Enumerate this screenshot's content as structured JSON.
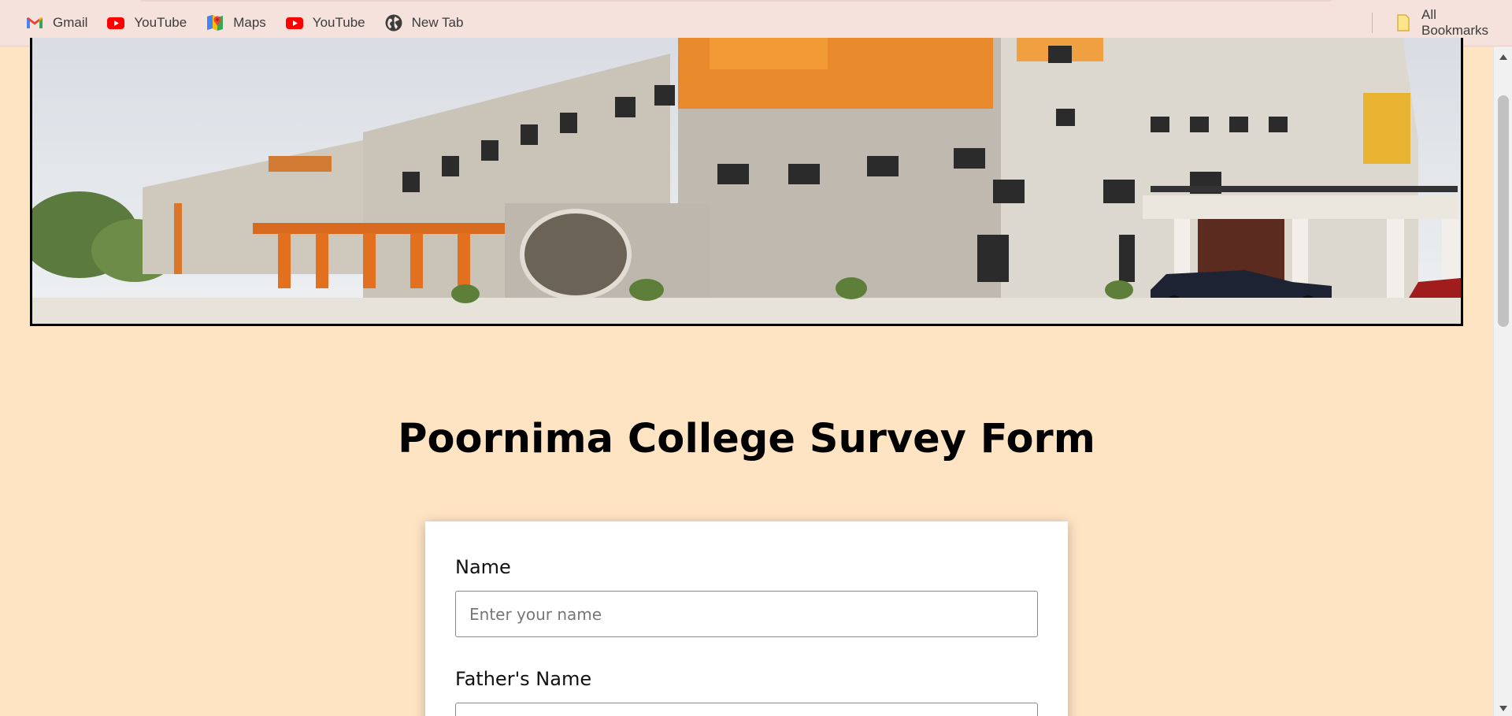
{
  "bookmarks": [
    {
      "label": "Gmail",
      "icon": "gmail-icon"
    },
    {
      "label": "YouTube",
      "icon": "youtube-icon"
    },
    {
      "label": "Maps",
      "icon": "maps-icon"
    },
    {
      "label": "YouTube",
      "icon": "youtube-icon"
    },
    {
      "label": "New Tab",
      "icon": "globe-icon"
    }
  ],
  "all_bookmarks": {
    "label": "All Bookmarks",
    "icon": "folder-icon"
  },
  "page": {
    "title": "Poornima College Survey Form",
    "background_color": "#ffe4c4"
  },
  "form": {
    "fields": [
      {
        "label": "Name",
        "placeholder": "Enter your name"
      },
      {
        "label": "Father's Name",
        "placeholder": ""
      }
    ]
  }
}
